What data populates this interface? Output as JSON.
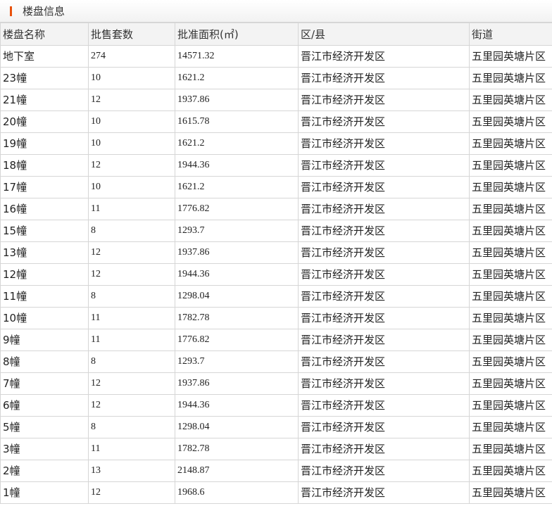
{
  "panel": {
    "title": "楼盘信息"
  },
  "table": {
    "headers": [
      "楼盘名称",
      "批售套数",
      "批准面积(㎡)",
      "区/县",
      "街道"
    ],
    "rows": [
      [
        "地下室",
        "274",
        "14571.32",
        "晋江市经济开发区",
        "五里园英塘片区"
      ],
      [
        "23幢",
        "10",
        "1621.2",
        "晋江市经济开发区",
        "五里园英塘片区"
      ],
      [
        "21幢",
        "12",
        "1937.86",
        "晋江市经济开发区",
        "五里园英塘片区"
      ],
      [
        "20幢",
        "10",
        "1615.78",
        "晋江市经济开发区",
        "五里园英塘片区"
      ],
      [
        "19幢",
        "10",
        "1621.2",
        "晋江市经济开发区",
        "五里园英塘片区"
      ],
      [
        "18幢",
        "12",
        "1944.36",
        "晋江市经济开发区",
        "五里园英塘片区"
      ],
      [
        "17幢",
        "10",
        "1621.2",
        "晋江市经济开发区",
        "五里园英塘片区"
      ],
      [
        "16幢",
        "11",
        "1776.82",
        "晋江市经济开发区",
        "五里园英塘片区"
      ],
      [
        "15幢",
        "8",
        "1293.7",
        "晋江市经济开发区",
        "五里园英塘片区"
      ],
      [
        "13幢",
        "12",
        "1937.86",
        "晋江市经济开发区",
        "五里园英塘片区"
      ],
      [
        "12幢",
        "12",
        "1944.36",
        "晋江市经济开发区",
        "五里园英塘片区"
      ],
      [
        "11幢",
        "8",
        "1298.04",
        "晋江市经济开发区",
        "五里园英塘片区"
      ],
      [
        "10幢",
        "11",
        "1782.78",
        "晋江市经济开发区",
        "五里园英塘片区"
      ],
      [
        "9幢",
        "11",
        "1776.82",
        "晋江市经济开发区",
        "五里园英塘片区"
      ],
      [
        "8幢",
        "8",
        "1293.7",
        "晋江市经济开发区",
        "五里园英塘片区"
      ],
      [
        "7幢",
        "12",
        "1937.86",
        "晋江市经济开发区",
        "五里园英塘片区"
      ],
      [
        "6幢",
        "12",
        "1944.36",
        "晋江市经济开发区",
        "五里园英塘片区"
      ],
      [
        "5幢",
        "8",
        "1298.04",
        "晋江市经济开发区",
        "五里园英塘片区"
      ],
      [
        "3幢",
        "11",
        "1782.78",
        "晋江市经济开发区",
        "五里园英塘片区"
      ],
      [
        "2幢",
        "13",
        "2148.87",
        "晋江市经济开发区",
        "五里园英塘片区"
      ],
      [
        "1幢",
        "12",
        "1968.6",
        "晋江市经济开发区",
        "五里园英塘片区"
      ]
    ]
  },
  "colors": {
    "accent": "#e8510c",
    "border": "#d6d6d6",
    "header_bg": "#f3f3f3"
  }
}
